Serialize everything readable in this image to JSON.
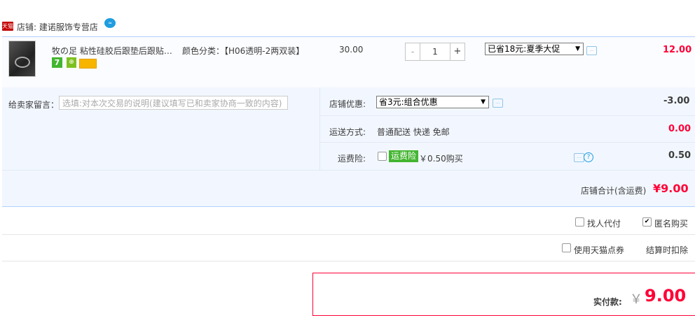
{
  "shop": {
    "badge": "天猫",
    "name": "店铺: 建诺服饰专营店",
    "chat_icon": "chat-bubble-icon"
  },
  "item": {
    "title": "牧の足 粘性硅胶后跟垫后跟贴后跟",
    "sku_label": "颜色分类：【H06透明-2两双装】",
    "price": "30.00",
    "quantity": "1",
    "minus": "-",
    "plus": "+",
    "promo_select": "已省18元:夏季大促",
    "subtotal": "12.00",
    "badge_7": "7",
    "icons": [
      "seven-day-return-icon",
      "guarantee-shield-icon",
      "credit-card-icon"
    ]
  },
  "memo": {
    "label": "给卖家留言：",
    "placeholder": "选填:对本次交易的说明(建议填写已和卖家协商一致的内容)"
  },
  "discount": {
    "label": "店铺优惠:",
    "select": "省3元:组合优惠",
    "amount": "-3.00"
  },
  "shipping": {
    "label": "运送方式:",
    "value": "普通配送 快递 免邮",
    "amount": "0.00"
  },
  "insurance": {
    "label": "运费险:",
    "badge": "运费险",
    "value": "￥0.50购买",
    "amount": "0.50"
  },
  "shop_total": {
    "label": "店铺合计(含运费)",
    "amount": "¥9.00"
  },
  "options": {
    "proxy": "找人代付",
    "anonymous": "匿名购买",
    "tmall_points": "使用天猫点券",
    "deduct_note": "结算时扣除"
  },
  "payment": {
    "label": "实付款:",
    "currency": "￥",
    "amount": "9.00"
  },
  "colors": {
    "accent_red": "#ff0036",
    "row_blue": "#f2f7ff",
    "border_blue": "#b2d1ff",
    "tmall_red": "#c40000",
    "green_badge": "#43b530"
  }
}
